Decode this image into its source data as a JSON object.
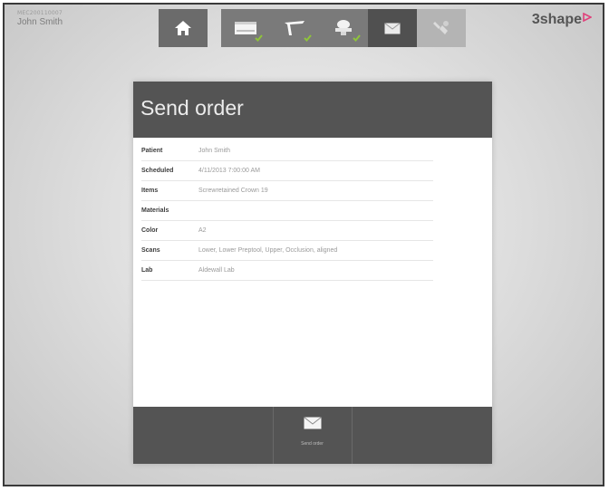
{
  "patient": {
    "id": "MEC200110007",
    "name": "John Smith"
  },
  "brand": {
    "logo_text": "3shape"
  },
  "toolbar": {
    "buttons": [
      {
        "icon": "home-icon",
        "state": "normal"
      },
      {
        "icon": "order-form-icon",
        "state": "done"
      },
      {
        "icon": "prepare-icon",
        "state": "done"
      },
      {
        "icon": "scan-icon",
        "state": "done"
      },
      {
        "icon": "envelope-icon",
        "state": "active"
      },
      {
        "icon": "tools-icon",
        "state": "disabled"
      }
    ]
  },
  "dialog": {
    "title": "Send order",
    "rows": [
      {
        "label": "Patient",
        "value": "John Smith"
      },
      {
        "label": "Scheduled",
        "value": "4/11/2013 7:00:00 AM"
      },
      {
        "label": "Items",
        "value": "Screwretained Crown 19"
      },
      {
        "label": "Materials",
        "value": ""
      },
      {
        "label": "Color",
        "value": "A2"
      },
      {
        "label": "Scans",
        "value": "Lower, Lower Preptool, Upper, Occlusion, aligned"
      },
      {
        "label": "Lab",
        "value": "Aldewall Lab"
      }
    ],
    "footer": {
      "send_label": "Send order"
    }
  },
  "colors": {
    "header_bg": "#545454",
    "toolbar_bg": "#7a7a7a",
    "check_green": "#8fc43a",
    "logo_accent": "#e0407a"
  }
}
